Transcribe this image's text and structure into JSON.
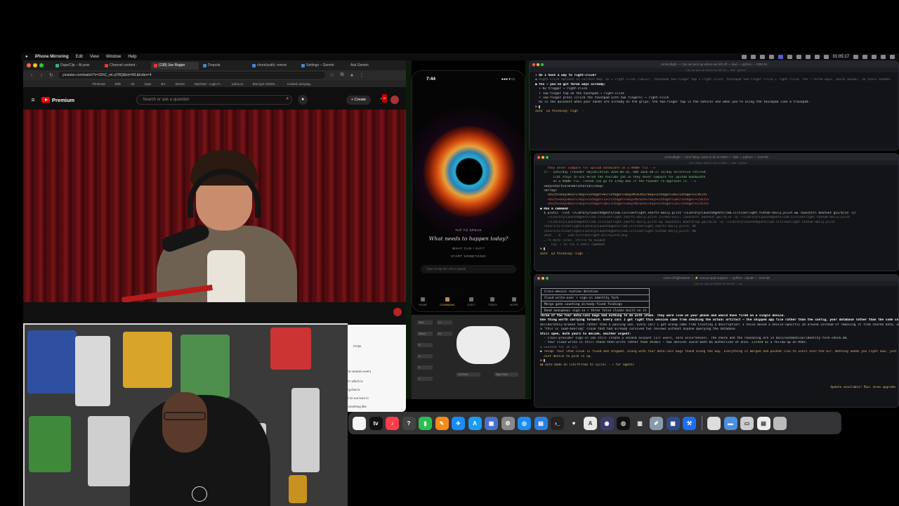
{
  "menubar": {
    "app": "iPhone Mirroring",
    "items": [
      "Edit",
      "View",
      "Window",
      "Help"
    ],
    "clock": "01:05:17"
  },
  "browser": {
    "tabs": [
      {
        "label": "DupeClip – AI-pow",
        "active": false
      },
      {
        "label": "Channel content -",
        "active": false
      },
      {
        "label": "(138) Joe Rogan",
        "active": true
      },
      {
        "label": "Dropola",
        "active": false
      },
      {
        "label": "chore(auth): remov",
        "active": false
      },
      {
        "label": "Settings – Gemini",
        "active": false
      },
      {
        "label": "Ask Gemini",
        "active": false
      }
    ],
    "url": "youtube.com/watch?v=32hC_mLqY8Q&list=WL&index=4",
    "bookmarks": [
      "Threlexta",
      "Bills",
      "All",
      "Apps",
      "BV",
      "Stocks",
      "MyChart - Login P...",
      "polus.ai",
      "Biocrypt 1/2025...",
      "Limited campaig..."
    ],
    "youtube": {
      "logo": "Premium",
      "search_placeholder": "Search or ask a question",
      "create": "+ Create",
      "bell_badge": "9+"
    }
  },
  "side_panel": {
    "lines": [
      "FAQs",
      "the random event",
      "VC which is",
      "ing that is",
      "ul so not sure in",
      "something like"
    ]
  },
  "phone": {
    "time": "7:44",
    "status": "●●● ▾ ▭",
    "tap_to_speak": "TAP TO SPEAK",
    "prompt": "What needs to happen today?",
    "option_1": "WHAT CAN I SAY?",
    "option_2": "START SOMETHING",
    "input_placeholder": "Type or tap the orb to speak",
    "tabs": [
      "HOME",
      "COMMAND",
      "DAILY",
      "TASKS",
      "MORE"
    ],
    "active_tab": "COMMAND"
  },
  "controller_keys": [
    "Start",
    "Select",
    "B",
    "A",
    "X",
    "Y",
    "L1",
    "R1",
    "Left Stick",
    "Right Stick"
  ],
  "term1": {
    "title": "circleoflight — Can we pick up where we left off — kiwi — python — 209×18",
    "sub": "… Can we pick up where we left off — kiwi · python",
    "lines": [
      {
        "t": "✦ Do I have a way to right-click?",
        "c": "tl-white"
      },
      {
        "t": "",
        "c": ""
      },
      {
        "t": "● Right-click options in current map: R2 = right click (id=11), touchpad two-finger tap = right click, touchpad two-finger click = right click. Yes — three ways. Quick answer, no tools needed.",
        "c": "tl-mut"
      },
      {
        "t": "",
        "c": ""
      },
      {
        "t": "● Yes — you've got three ways already:",
        "c": "tl-white"
      },
      {
        "t": "",
        "c": ""
      },
      {
        "t": "  • R2 trigger → right-click",
        "c": ""
      },
      {
        "t": "  • Two-finger tap on the touchpad → right-click",
        "c": ""
      },
      {
        "t": "  • Two-finger press (click the touchpad with two fingers) → right-click",
        "c": ""
      },
      {
        "t": "",
        "c": ""
      },
      {
        "t": "  R2 is the quickest when your hands are already on the grips; the two-finger tap is the natural one when you're using the touchpad like a trackpad.",
        "c": ""
      },
      {
        "t": "",
        "c": ""
      },
      {
        "t": "> ▌",
        "c": "tl-white"
      },
      {
        "t": "",
        "c": ""
      },
      {
        "t": "auto  ◎3 thinking: high  ·",
        "c": "tl-acc"
      }
    ]
  },
  "term2": {
    "title": "circleoflight — One thing I want to do is rethin — kiwi — python — 213×30",
    "sub": "… One thing I want to do is rethin — kiwi · python",
    "lines": [
      {
        "t": "    they never compare for upload bandwidth on a ARBN+ fix -->",
        "c": "tl-red"
      },
      {
        "t": "  <!-- Saturday (founder adjudication 2026-08-16, ADR 2026-08-27 3x/day directive retired.",
        "c": "tl-green"
      },
      {
        "t": "       Clat stays 1h w/o AFTER the YouTube job so they never compare for upload bandwidth",
        "c": "tl-green"
      },
      {
        "t": "       on a ARBN+ fix. Tiktok can go to 1/day max if the founder re-approves it. -->",
        "c": "tl-green"
      },
      {
        "t": "  <key>StartCalendarInterval</key>",
        "c": ""
      },
      {
        "t": "  <array>",
        "c": ""
      },
      {
        "t": "    <dict><key>Hour</key><integer>9</integer><key>Minute</key><integer>16</integer></dict>",
        "c": "tl-acc"
      },
      {
        "t": "    <dict><key>Hour</key><integer>13</integer><key>Minute</key><integer>20</integer></dict>",
        "c": "tl-red"
      },
      {
        "t": "    <dict><key>Hour</key><integer>18</integer><key>Minute</key><integer>31</integer></dict>",
        "c": "tl-red"
      },
      {
        "t": "",
        "c": ""
      },
      {
        "t": "● Ran a command",
        "c": "tl-white"
      },
      {
        "t": "  $ plutil -lint ~/Library/LaunchAgents/com.circleoflight.shorts-daily.plist ~/Library/LaunchAgents/com.circleoflight.tiktok-daily.plist && launchctl bootout gui/$(id -u)",
        "c": ""
      },
      {
        "t": "    ~/Library/LaunchAgents/com.circleoflight.shorts-daily.plist 2>/dev/null; launchctl bootout gui/$(id -u) ~/Library/LaunchAgents/com.circleoflight.tiktok-daily.plist",
        "c": "tl-mut"
      },
      {
        "t": "    ~/Library/LaunchAgents/com.circleoflight.shorts-daily.plist && launchctl bootstrap gui/$(id -u) ~/Library/LaunchAgents/com.circleoflight.tiktok-daily.plist",
        "c": "tl-mut"
      },
      {
        "t": "  /Users/circleoflight/Library/LaunchAgents/com.circleoflight.shorts-daily.plist: OK",
        "c": "tl-mut"
      },
      {
        "t": "  /Users/circleoflight/Library/LaunchAgents/com.circleoflight.tiktok-daily.plist: OK",
        "c": "tl-mut"
      },
      {
        "t": "  3424    0    com.circleoflight.killswitch-mcp",
        "c": "tl-mut"
      },
      {
        "t": "  … +5 more lines, ctrl+o to expand",
        "c": "tl-mut"
      },
      {
        "t": "",
        "c": ""
      },
      {
        "t": "  ⎿  Tip: / to run a shell command",
        "c": "tl-mut"
      },
      {
        "t": "",
        "c": ""
      },
      {
        "t": "> ▌",
        "c": "tl-white"
      },
      {
        "t": "",
        "c": ""
      },
      {
        "t": "auto  ◎3 thinking: high  ·",
        "c": "tl-acc"
      }
    ]
  },
  "term3": {
    "title": "circle-of-light-ttests — ⚡ rescue-ipad-support — python · claude — 213×38",
    "sub": "… Can we pick up where we left off — cut",
    "table": [
      "Cross-device routine deletion",
      "Cloud write-over + sign-in identity fork",
      "Merge gate counting already-fixed findings",
      "Dead anonymous sign-in + three false claims built on it"
    ],
    "lines": [
      {
        "t": "",
        "c": ""
      },
      {
        "t": "Three of the four data-loss bugs had nothing to do with iPads. They were live on your phone and would have fired on a single device.",
        "c": "tl-white"
      },
      {
        "t": "",
        "c": ""
      },
      {
        "t": "One thing worth carrying forward. Every call I got right this session came from checking the actual artifact — the shipped app file rather than the config, your database rather than the code comment,",
        "c": "tl-white"
      },
      {
        "t": "deliberately-broken test rather than a passing one. Every call I got wrong came from trusting a description: I twice moved a device-specific ID around instead of removing it from shared data, and I twice repeated",
        "c": ""
      },
      {
        "t": "a \"this is load-bearing\" claim that had already survived two reviews without anyone querying the database.",
        "c": ""
      },
      {
        "t": "",
        "c": ""
      },
      {
        "t": "Still open, both yours to decide, neither urgent:",
        "c": "tl-white"
      },
      {
        "t": "  - Cross-provider sign-in can still create a second account (177 users, zero occurrences). The check and the reasoning are in docs/automation/identity-fork-check.md.",
        "c": ""
      },
      {
        "t": "  - Your cloud write is still check-then-write rather than atomic — two devices could both be authorised at once. Listed as a follow-up on #465.",
        "c": ""
      },
      {
        "t": "",
        "c": ""
      },
      {
        "t": "✻ Sauteed for 3m 22s",
        "c": "tl-mut"
      },
      {
        "t": "",
        "c": ""
      },
      {
        "t": "● recap: Your iPad issue is fixed and shipped, along with four data-loss bugs found along the way. Everything is merged and pushed live to users over-the-air. Nothing needs you right now; just open the",
        "c": "tl-acc"
      },
      {
        "t": "  cost device to pick it up.",
        "c": "tl-acc"
      },
      {
        "t": "",
        "c": ""
      },
      {
        "t": "> ▌",
        "c": "tl-white"
      },
      {
        "t": "",
        "c": ""
      },
      {
        "t": "⏵⏵ auto mode on (shift+tab to cycle) · ← for agents",
        "c": "tl-acc"
      }
    ],
    "update": "Update available! Run: brew upgrade"
  },
  "dock": {
    "icons": [
      "notes",
      "apple-tv",
      "music",
      "tips",
      "numbers",
      "pages",
      "testflight",
      "app-store",
      "xcode-simulator",
      "system-settings",
      "safari",
      "finder-files",
      "terminal",
      "activity-monitor",
      "affinity",
      "obs",
      "chatgpt",
      "instruments",
      "script-editor",
      "xcode-remote",
      "xcode",
      "document",
      "folder",
      "image-capture",
      "preview",
      "trash"
    ]
  }
}
